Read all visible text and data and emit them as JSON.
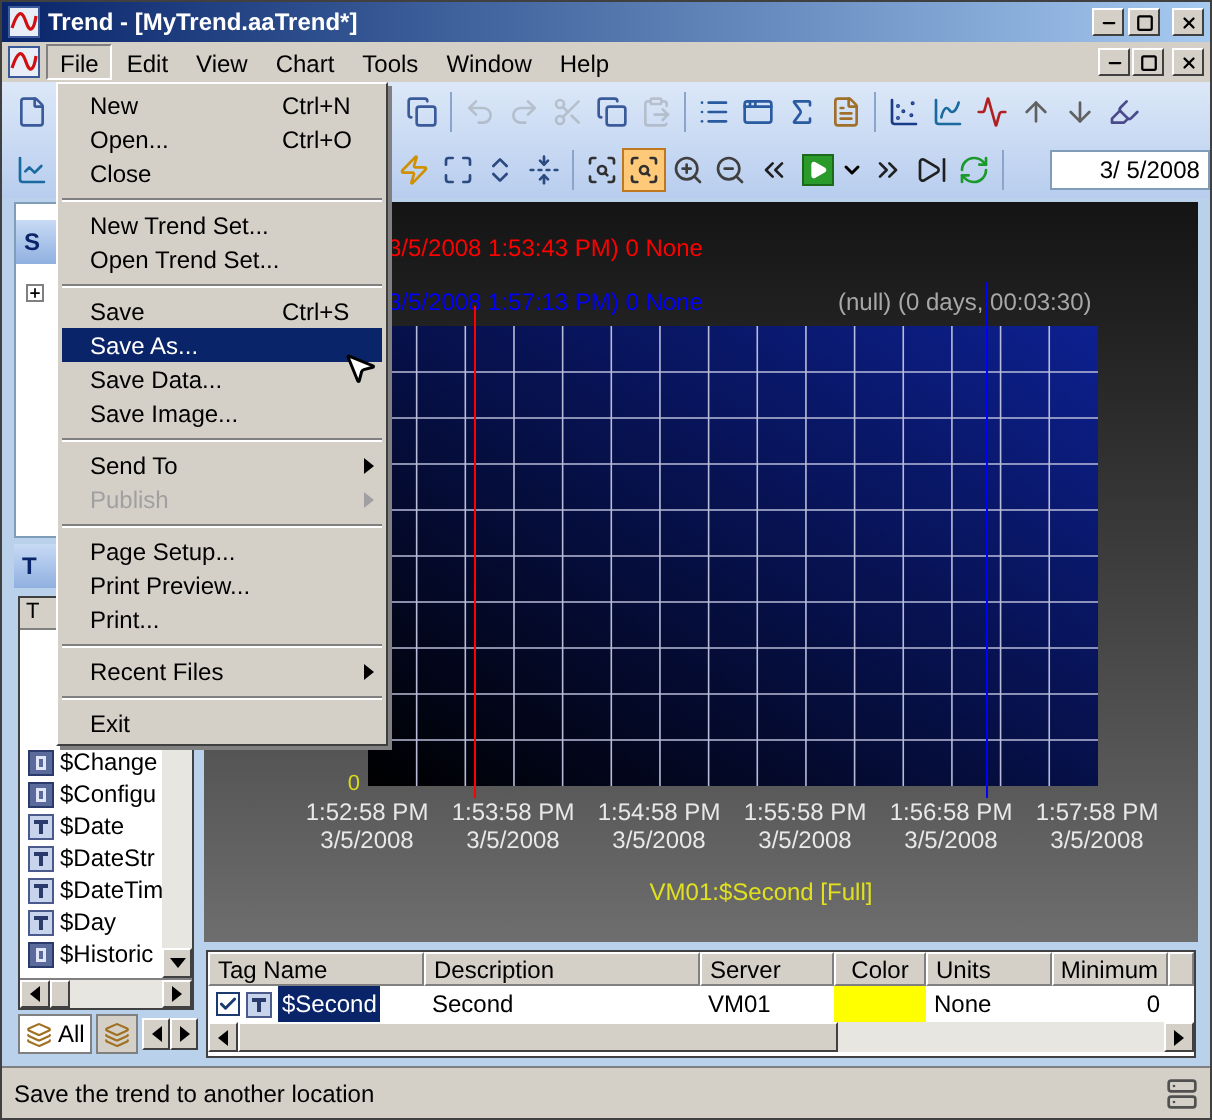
{
  "window": {
    "title": "Trend - [MyTrend.aaTrend*]"
  },
  "menu_bar": [
    {
      "label": "File",
      "selected": true
    },
    {
      "label": "Edit",
      "selected": false
    },
    {
      "label": "View",
      "selected": false
    },
    {
      "label": "Chart",
      "selected": false
    },
    {
      "label": "Tools",
      "selected": false
    },
    {
      "label": "Window",
      "selected": false
    },
    {
      "label": "Help",
      "selected": false
    }
  ],
  "file_menu": [
    {
      "kind": "item",
      "label": "New",
      "shortcut": "Ctrl+N",
      "selected": false,
      "disabled": false,
      "submenu": false
    },
    {
      "kind": "item",
      "label": "Open...",
      "shortcut": "Ctrl+O",
      "selected": false,
      "disabled": false,
      "submenu": false
    },
    {
      "kind": "item",
      "label": "Close",
      "selected": false,
      "disabled": false,
      "submenu": false
    },
    {
      "kind": "separator"
    },
    {
      "kind": "item",
      "label": "New Trend Set...",
      "selected": false,
      "disabled": false,
      "submenu": false
    },
    {
      "kind": "item",
      "label": "Open Trend Set...",
      "selected": false,
      "disabled": false,
      "submenu": false
    },
    {
      "kind": "separator"
    },
    {
      "kind": "item",
      "label": "Save",
      "shortcut": "Ctrl+S",
      "selected": false,
      "disabled": false,
      "submenu": false
    },
    {
      "kind": "item",
      "label": "Save As...",
      "selected": true,
      "disabled": false,
      "submenu": false
    },
    {
      "kind": "item",
      "label": "Save Data...",
      "selected": false,
      "disabled": false,
      "submenu": false
    },
    {
      "kind": "item",
      "label": "Save Image...",
      "selected": false,
      "disabled": false,
      "submenu": false
    },
    {
      "kind": "separator"
    },
    {
      "kind": "item",
      "label": "Send To",
      "selected": false,
      "disabled": false,
      "submenu": true
    },
    {
      "kind": "item",
      "label": "Publish",
      "selected": false,
      "disabled": true,
      "submenu": true
    },
    {
      "kind": "separator"
    },
    {
      "kind": "item",
      "label": "Page Setup...",
      "selected": false,
      "disabled": false,
      "submenu": false
    },
    {
      "kind": "item",
      "label": "Print Preview...",
      "selected": false,
      "disabled": false,
      "submenu": false
    },
    {
      "kind": "item",
      "label": "Print...",
      "selected": false,
      "disabled": false,
      "submenu": false
    },
    {
      "kind": "separator"
    },
    {
      "kind": "item",
      "label": "Recent Files",
      "selected": false,
      "disabled": false,
      "submenu": true
    },
    {
      "kind": "separator"
    },
    {
      "kind": "item",
      "label": "Exit",
      "selected": false,
      "disabled": false,
      "submenu": false
    }
  ],
  "toolbar_1": [
    {
      "kind": "new",
      "disabled": false
    },
    {
      "kind": "cascade",
      "disabled": false
    },
    {
      "kind": "separator"
    },
    {
      "kind": "undo",
      "disabled": true
    },
    {
      "kind": "redo",
      "disabled": true
    },
    {
      "kind": "cut",
      "disabled": true
    },
    {
      "kind": "copy",
      "disabled": false
    },
    {
      "kind": "paste",
      "disabled": true
    },
    {
      "kind": "separator"
    },
    {
      "kind": "list",
      "disabled": false
    },
    {
      "kind": "window",
      "disabled": false
    },
    {
      "kind": "stats",
      "disabled": false
    },
    {
      "kind": "properties",
      "disabled": false
    },
    {
      "kind": "separator"
    },
    {
      "kind": "xy",
      "disabled": false
    },
    {
      "kind": "line",
      "disabled": false
    },
    {
      "kind": "multi",
      "disabled": false
    },
    {
      "kind": "up",
      "disabled": false
    },
    {
      "kind": "down",
      "disabled": false
    },
    {
      "kind": "highlight",
      "disabled": false
    }
  ],
  "toolbar_2": [
    {
      "kind": "chart",
      "selected": false
    },
    {
      "kind": "lightning",
      "selected": false
    },
    {
      "kind": "fit",
      "selected": false
    },
    {
      "kind": "stretch",
      "selected": false
    },
    {
      "kind": "compress",
      "selected": false
    },
    {
      "kind": "separator"
    },
    {
      "kind": "zoom-box",
      "selected": false
    },
    {
      "kind": "zoom-box",
      "selected": true
    },
    {
      "kind": "zoom-in",
      "selected": false
    },
    {
      "kind": "zoom-out",
      "selected": false
    },
    {
      "kind": "rewind",
      "selected": false
    },
    {
      "kind": "play",
      "selected": false
    },
    {
      "kind": "caret",
      "selected": false
    },
    {
      "kind": "forward",
      "selected": false
    },
    {
      "kind": "end",
      "selected": false
    },
    {
      "kind": "refresh",
      "selected": false
    },
    {
      "kind": "separator"
    }
  ],
  "date_field": {
    "value": "3/ 5/2008"
  },
  "servers_panel": {
    "header": "S",
    "tree_node": {
      "expanded": false
    }
  },
  "tags_panel": {
    "header": "T",
    "column": "T",
    "rows": [
      {
        "kind": "integer",
        "label": "$Change"
      },
      {
        "kind": "integer",
        "label": "$Configu"
      },
      {
        "kind": "string",
        "label": "$Date"
      },
      {
        "kind": "string",
        "label": "$DateStr"
      },
      {
        "kind": "string",
        "label": "$DateTim"
      },
      {
        "kind": "string",
        "label": "$Day"
      },
      {
        "kind": "integer",
        "label": "$Historic"
      }
    ],
    "tabs": [
      {
        "label": "All",
        "selected": true
      },
      {
        "selected": false
      }
    ]
  },
  "chart": {
    "cursors": [
      {
        "label": "3/5/2008 1:53:43 PM) 0 None",
        "color": "#ff0000"
      },
      {
        "label": "3/5/2008 1:57:13 PM) 0 None",
        "color": "#0000ff"
      }
    ],
    "span": "(null) (0 days, 00:03:30)",
    "y_label": "0",
    "x_labels": [
      {
        "time": "1:52:58 PM",
        "date": "3/5/2008"
      },
      {
        "time": "1:53:58 PM",
        "date": "3/5/2008"
      },
      {
        "time": "1:54:58 PM",
        "date": "3/5/2008"
      },
      {
        "time": "1:55:58 PM",
        "date": "3/5/2008"
      },
      {
        "time": "1:56:58 PM",
        "date": "3/5/2008"
      },
      {
        "time": "1:57:58 PM",
        "date": "3/5/2008"
      }
    ],
    "legend": "VM01:$Second [Full]"
  },
  "table": {
    "columns": [
      "Tag Name",
      "Description",
      "Server",
      "Color",
      "Units",
      "Minimum"
    ],
    "rows": [
      {
        "checked": true,
        "selected": true,
        "tag_name": "$Second",
        "description": "Second",
        "server": "VM01",
        "color": "#ffff00",
        "units": "None",
        "minimum": "0"
      }
    ]
  },
  "status_bar": {
    "text": "Save the trend to another location"
  }
}
